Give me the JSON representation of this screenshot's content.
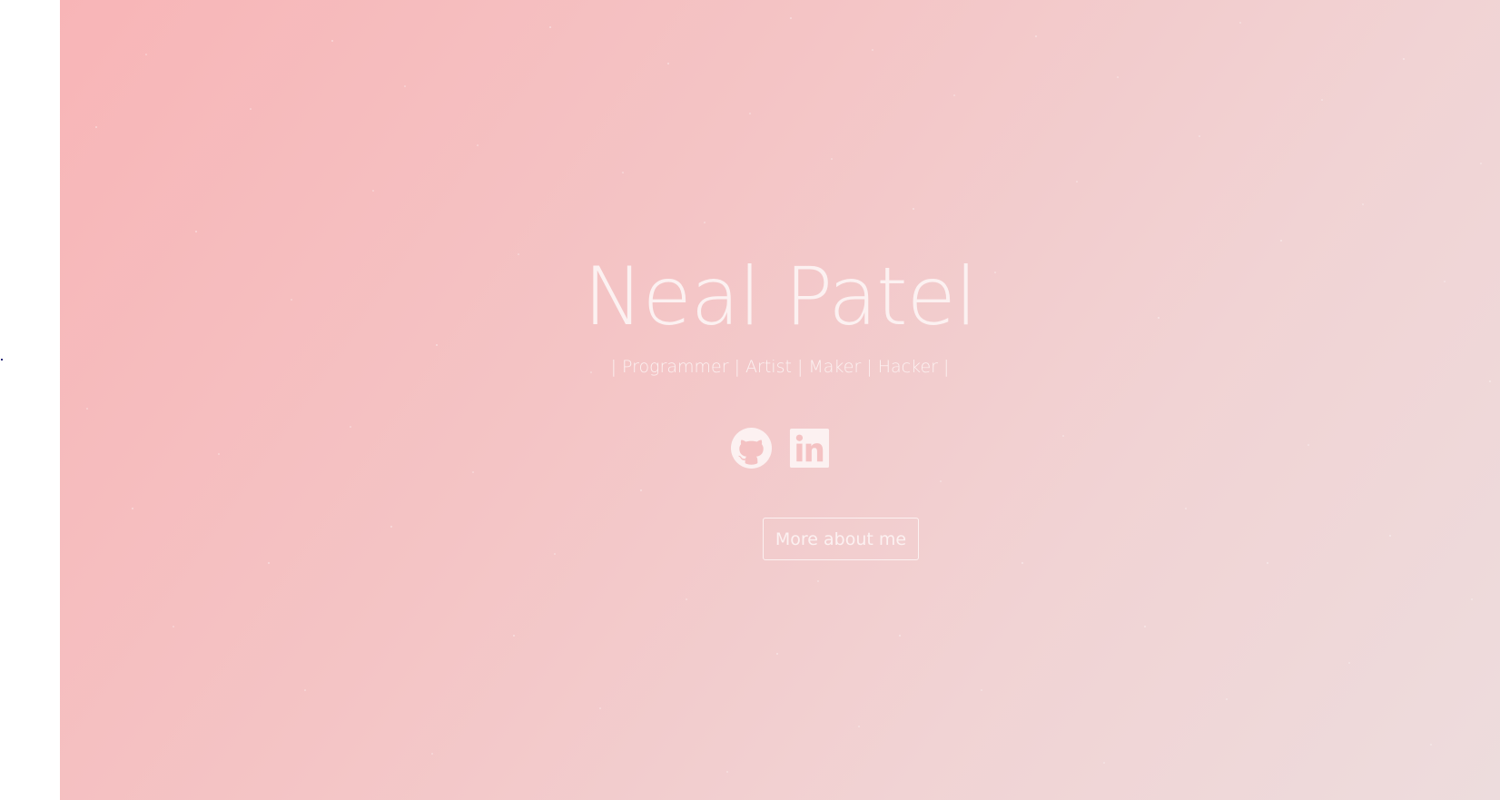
{
  "hero": {
    "name": "Neal Patel",
    "tagline": "| Programmer | Artist | Maker | Hacker |",
    "cta_label": "More about me"
  },
  "socials": [
    {
      "icon": "github-icon"
    },
    {
      "icon": "linkedin-icon"
    }
  ],
  "colors": {
    "gradient_start": "#f8b5b7",
    "gradient_end": "#eddcdd",
    "text": "#fcf1f1"
  }
}
